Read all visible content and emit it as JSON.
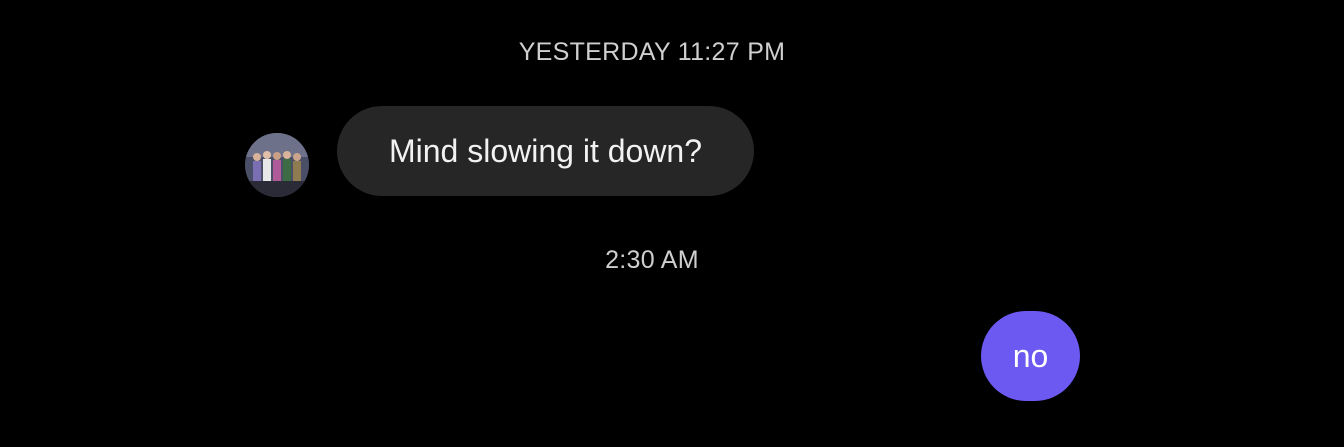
{
  "conversation": {
    "timestamps": [
      "YESTERDAY 11:27 PM",
      "2:30 AM"
    ],
    "messages": [
      {
        "direction": "incoming",
        "text": "Mind slowing it down?"
      },
      {
        "direction": "outgoing",
        "text": "no"
      }
    ]
  },
  "colors": {
    "background": "#000000",
    "incoming_bubble": "#262626",
    "outgoing_bubble": "#6b59f2",
    "timestamp_text": "#cfcfcf"
  },
  "icons": {
    "avatar": "group-photo-avatar"
  }
}
